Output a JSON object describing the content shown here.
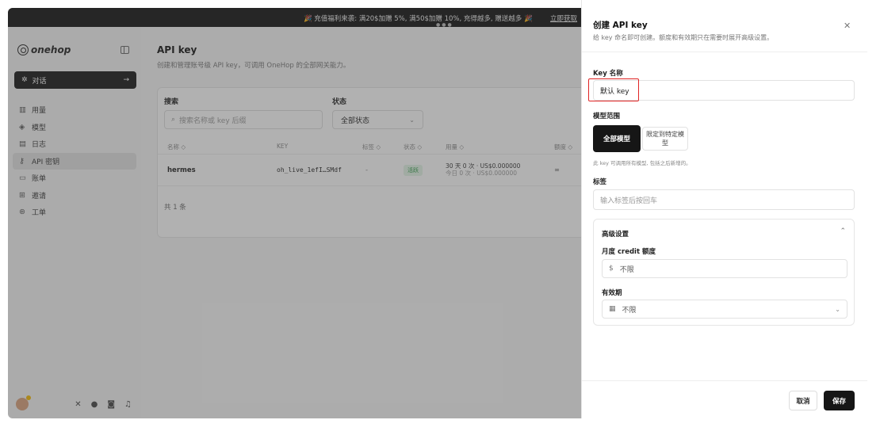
{
  "banner": {
    "text": "🎉 充值福利来袭: 满20$加赠 5%, 满50$加赠 10%, 充得越多, 赠送越多 🎉",
    "link": "立即获取"
  },
  "sidebar": {
    "logo": "onehop",
    "chat_label": "对话",
    "items": [
      {
        "label": "用量",
        "icon": "chart-icon"
      },
      {
        "label": "模型",
        "icon": "layers-icon"
      },
      {
        "label": "日志",
        "icon": "log-icon"
      },
      {
        "label": "API 密钥",
        "icon": "key-icon",
        "active": true
      },
      {
        "label": "账单",
        "icon": "card-icon"
      },
      {
        "label": "邀请",
        "icon": "gift-icon"
      },
      {
        "label": "工单",
        "icon": "support-icon"
      }
    ]
  },
  "main": {
    "title": "API key",
    "subtitle": "创建和管理账号级 API key，可调用 OneHop 的全部网关能力。",
    "search_label": "搜索",
    "search_placeholder": "搜索名称或 key 后缀",
    "status_label": "状态",
    "status_value": "全部状态",
    "columns": [
      "名称 ◇",
      "KEY",
      "标签 ◇",
      "状态 ◇",
      "用量 ◇",
      "额度 ◇"
    ],
    "rows": [
      {
        "name": "hermes",
        "key": "oh_live_1efI…SMdf",
        "tags": "-",
        "status": "活跃",
        "usage_30d": "30 天 0 次 · US$0.000000",
        "usage_today": "今日 0 次 · US$0.000000",
        "quota": "∞"
      }
    ],
    "total": "共 1 条"
  },
  "drawer": {
    "title": "创建 API key",
    "subtitle": "给 key 命名即可创建。额度和有效期只在需要时展开高级设置。",
    "name_label": "Key 名称",
    "name_value": "默认 key",
    "scope_label": "模型范围",
    "scope_all": "全部模型",
    "scope_limited": "限定到特定模型",
    "scope_hint": "此 key 可调用所有模型, 包括之后新增的。",
    "tags_label": "标签",
    "tags_placeholder": "输入标签后按回车",
    "advanced_title": "高级设置",
    "credit_label": "月度 credit 额度",
    "credit_prefix": "$",
    "credit_value": "不限",
    "expiry_label": "有效期",
    "expiry_value": "不限",
    "cancel": "取消",
    "save": "保存"
  },
  "colors": {
    "primary_dark": "#161616",
    "highlight_red": "#e02424",
    "status_green": "#2e9a46"
  }
}
